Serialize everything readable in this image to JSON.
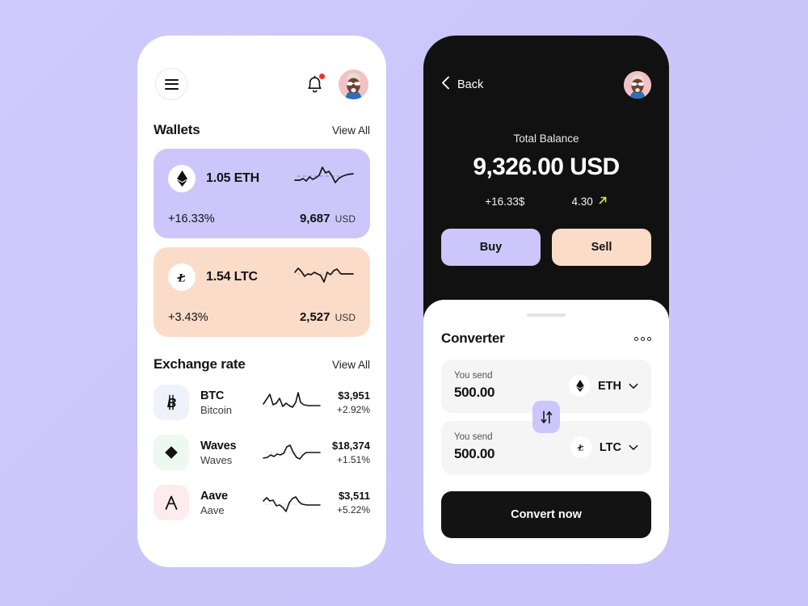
{
  "theme": {
    "background": "#cdc8fb",
    "accent_purple": "#cdc6fb",
    "accent_peach": "#fbdcc9",
    "dark": "#111111"
  },
  "left_phone": {
    "topbar": {
      "menu_icon": "hamburger-menu-icon",
      "bell_icon": "notification-bell-icon",
      "has_notification_dot": true,
      "avatar_icon": "user-avatar"
    },
    "wallets_section": {
      "title": "Wallets",
      "view_all": "View All",
      "cards": [
        {
          "icon": "ethereum-icon",
          "amount": "1.05 ETH",
          "change": "+16.33%",
          "fiat_value": "9,687",
          "fiat_currency": "USD",
          "bg": "#cdc6fb"
        },
        {
          "icon": "litecoin-icon",
          "amount": "1.54 LTC",
          "change": "+3.43%",
          "fiat_value": "2,527",
          "fiat_currency": "USD",
          "bg": "#fbdcc9"
        }
      ]
    },
    "exchange_section": {
      "title": "Exchange rate",
      "view_all": "View All",
      "rows": [
        {
          "icon": "bitcoin-icon",
          "symbol": "BTC",
          "name": "Bitcoin",
          "price": "$3,951",
          "change": "+2.92%",
          "tile_bg": "#eef3fb"
        },
        {
          "icon": "waves-icon",
          "symbol": "Waves",
          "name": "Waves",
          "price": "$18,374",
          "change": "+1.51%",
          "tile_bg": "#ecf8f0"
        },
        {
          "icon": "aave-icon",
          "symbol": "Aave",
          "name": "Aave",
          "price": "$3,511",
          "change": "+5.22%",
          "tile_bg": "#fcecee"
        }
      ]
    }
  },
  "right_phone": {
    "topbar": {
      "back_icon": "chevron-left-icon",
      "back_label": "Back",
      "avatar_icon": "user-avatar"
    },
    "balance": {
      "label": "Total Balance",
      "value": "9,326.00 USD",
      "delta": "+16.33$",
      "rate": "4.30",
      "trend_icon": "arrow-up-right-icon",
      "trend_color": "#d6f23a"
    },
    "actions": {
      "buy_label": "Buy",
      "sell_label": "Sell"
    },
    "converter": {
      "title": "Converter",
      "more_icon": "more-options-icon",
      "swap_icon": "swap-vertical-icon",
      "rows": [
        {
          "label": "You send",
          "value": "500.00",
          "coin_icon": "ethereum-icon",
          "coin_code": "ETH",
          "chevron": "chevron-down-icon"
        },
        {
          "label": "You send",
          "value": "500.00",
          "coin_icon": "litecoin-icon",
          "coin_code": "LTC",
          "chevron": "chevron-down-icon"
        }
      ],
      "convert_label": "Convert now"
    }
  }
}
